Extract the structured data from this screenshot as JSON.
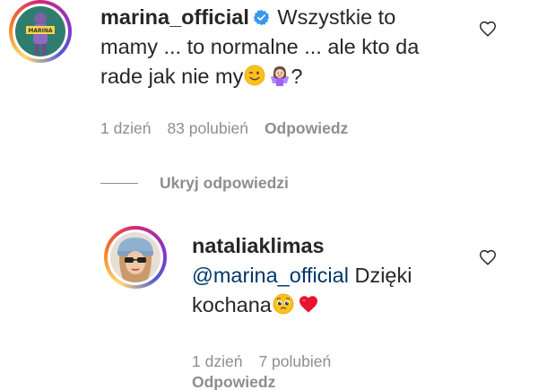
{
  "comment": {
    "username": "marina_official",
    "text_line1": "Wszystkie to",
    "text_line2": "mamy ... to normalne ... ale kto da",
    "text_line3_prefix": "rade jak nie my",
    "text_line3_suffix": "?",
    "time": "1 dzień",
    "likes": "83 polubień",
    "reply_label": "Odpowiedz",
    "emojis": [
      "winking-face",
      "woman-shrugging"
    ],
    "verified": true
  },
  "hide_replies": {
    "label": "Ukryj odpowiedzi"
  },
  "reply": {
    "username": "nataliaklimas",
    "mention": "@marina_official",
    "text_after_mention": " Dzięki",
    "text_line2": "kochana",
    "time": "1 dzień",
    "likes": "7 polubień",
    "reply_label": "Odpowiedz",
    "emojis": [
      "pleading-face",
      "red-heart"
    ]
  },
  "colors": {
    "text": "#262626",
    "muted": "#8e8e8e",
    "mention": "#00376b",
    "verified": "#3897f0",
    "heart_emoji": "#e8132e"
  }
}
